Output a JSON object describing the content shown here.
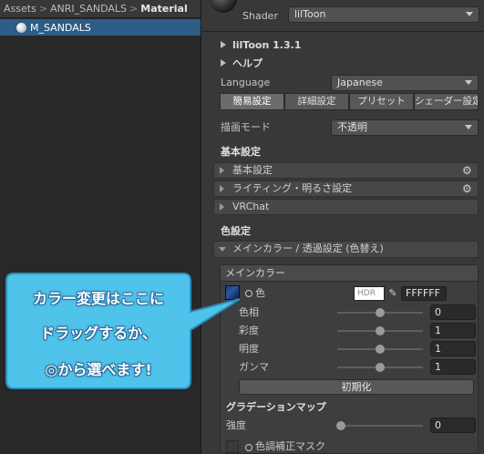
{
  "project_panel": {
    "breadcrumb": [
      "Assets",
      "ANRI_SANDALS",
      "Material"
    ],
    "breadcrumb_separator": ">",
    "selected_asset": "M_SANDALS"
  },
  "inspector": {
    "shader_label": "Shader",
    "shader_value": "lilToon",
    "version_label": "lilToon 1.3.1",
    "help_label": "ヘルプ",
    "language_label": "Language",
    "language_value": "Japanese",
    "tabs": [
      {
        "label": "簡易設定",
        "active": true
      },
      {
        "label": "詳細設定",
        "active": false
      },
      {
        "label": "プリセット",
        "active": false
      },
      {
        "label": "シェーダー設定",
        "active": false
      }
    ],
    "render_mode_label": "描画モード",
    "render_mode_value": "不透明",
    "basic_settings_title": "基本設定",
    "basic_groups": [
      {
        "label": "基本設定",
        "has_gear": true
      },
      {
        "label": "ライティング・明るさ設定",
        "has_gear": true
      },
      {
        "label": "VRChat",
        "has_gear": false
      }
    ],
    "color_settings_title": "色設定",
    "main_color_group_label": "メインカラー / 透過設定 (色替え)",
    "main_color": {
      "header": "メインカラー",
      "color_label": "色",
      "hdr_label": "HDR",
      "hex_value": "FFFFFF",
      "swatch_color": "#ffffff",
      "sliders": [
        {
          "label": "色相",
          "value": "0",
          "fraction": 0.5
        },
        {
          "label": "彩度",
          "value": "1",
          "fraction": 0.5
        },
        {
          "label": "明度",
          "value": "1",
          "fraction": 0.5
        },
        {
          "label": "ガンマ",
          "value": "1",
          "fraction": 0.5
        }
      ],
      "reset_label": "初期化",
      "gradation_title": "グラデーションマップ",
      "strength_label": "強度",
      "strength_value": "0",
      "strength_fraction": 0.0,
      "tone_correction_label": "色調補正マスク"
    }
  },
  "callout": {
    "lines": [
      "カラー変更はここに",
      "ドラッグするか、",
      "◎から選べます!"
    ],
    "fill_color": "#4fc3ea"
  }
}
